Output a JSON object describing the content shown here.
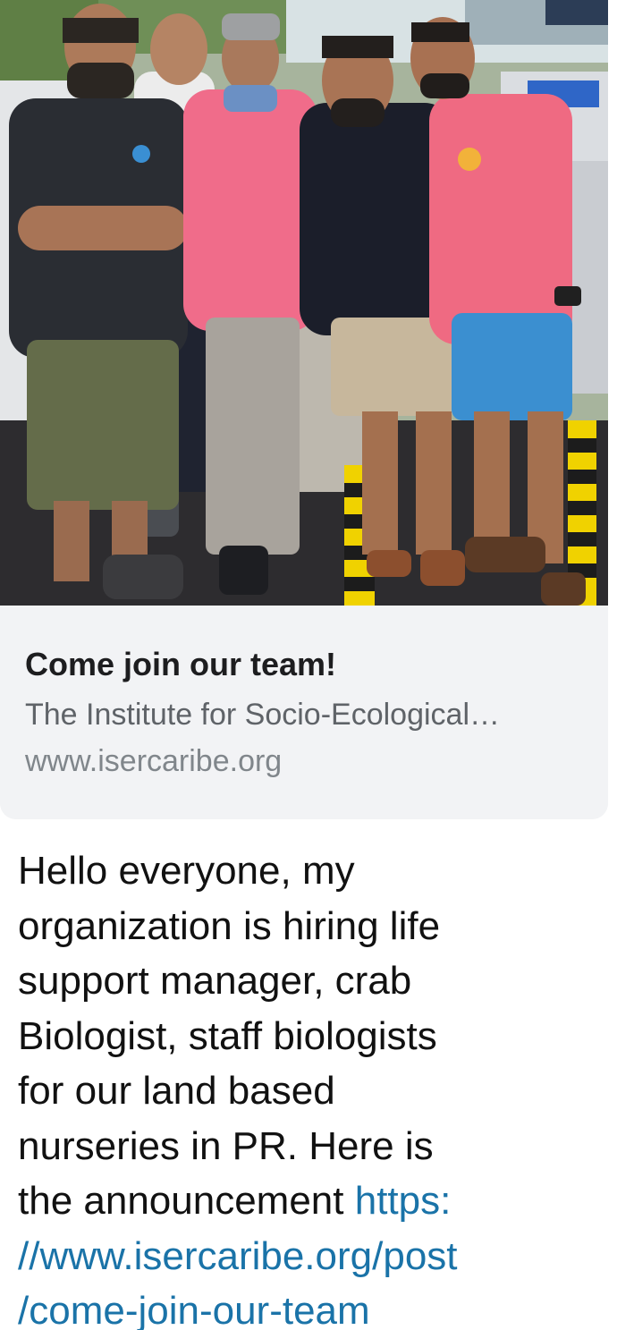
{
  "link_preview": {
    "image_description": "Five people standing together outdoors near aquarium tanks",
    "title": "Come join our team!",
    "description": "The Institute for Socio-Ecological…",
    "domain": "www.isercaribe.org"
  },
  "message": {
    "lines": [
      "Hello everyone, my",
      "organization is hiring life",
      "support manager, crab",
      "Biologist, staff biologists",
      "for our land based",
      "nurseries in PR. Here is"
    ],
    "last_line_prefix": "the announcement ",
    "link_lines": [
      "https:",
      "//www.isercaribe.org/post",
      "/come-join-our-team"
    ]
  },
  "colors": {
    "link": "#1a73a8",
    "card_background": "#f2f3f5",
    "text": "#111111"
  }
}
